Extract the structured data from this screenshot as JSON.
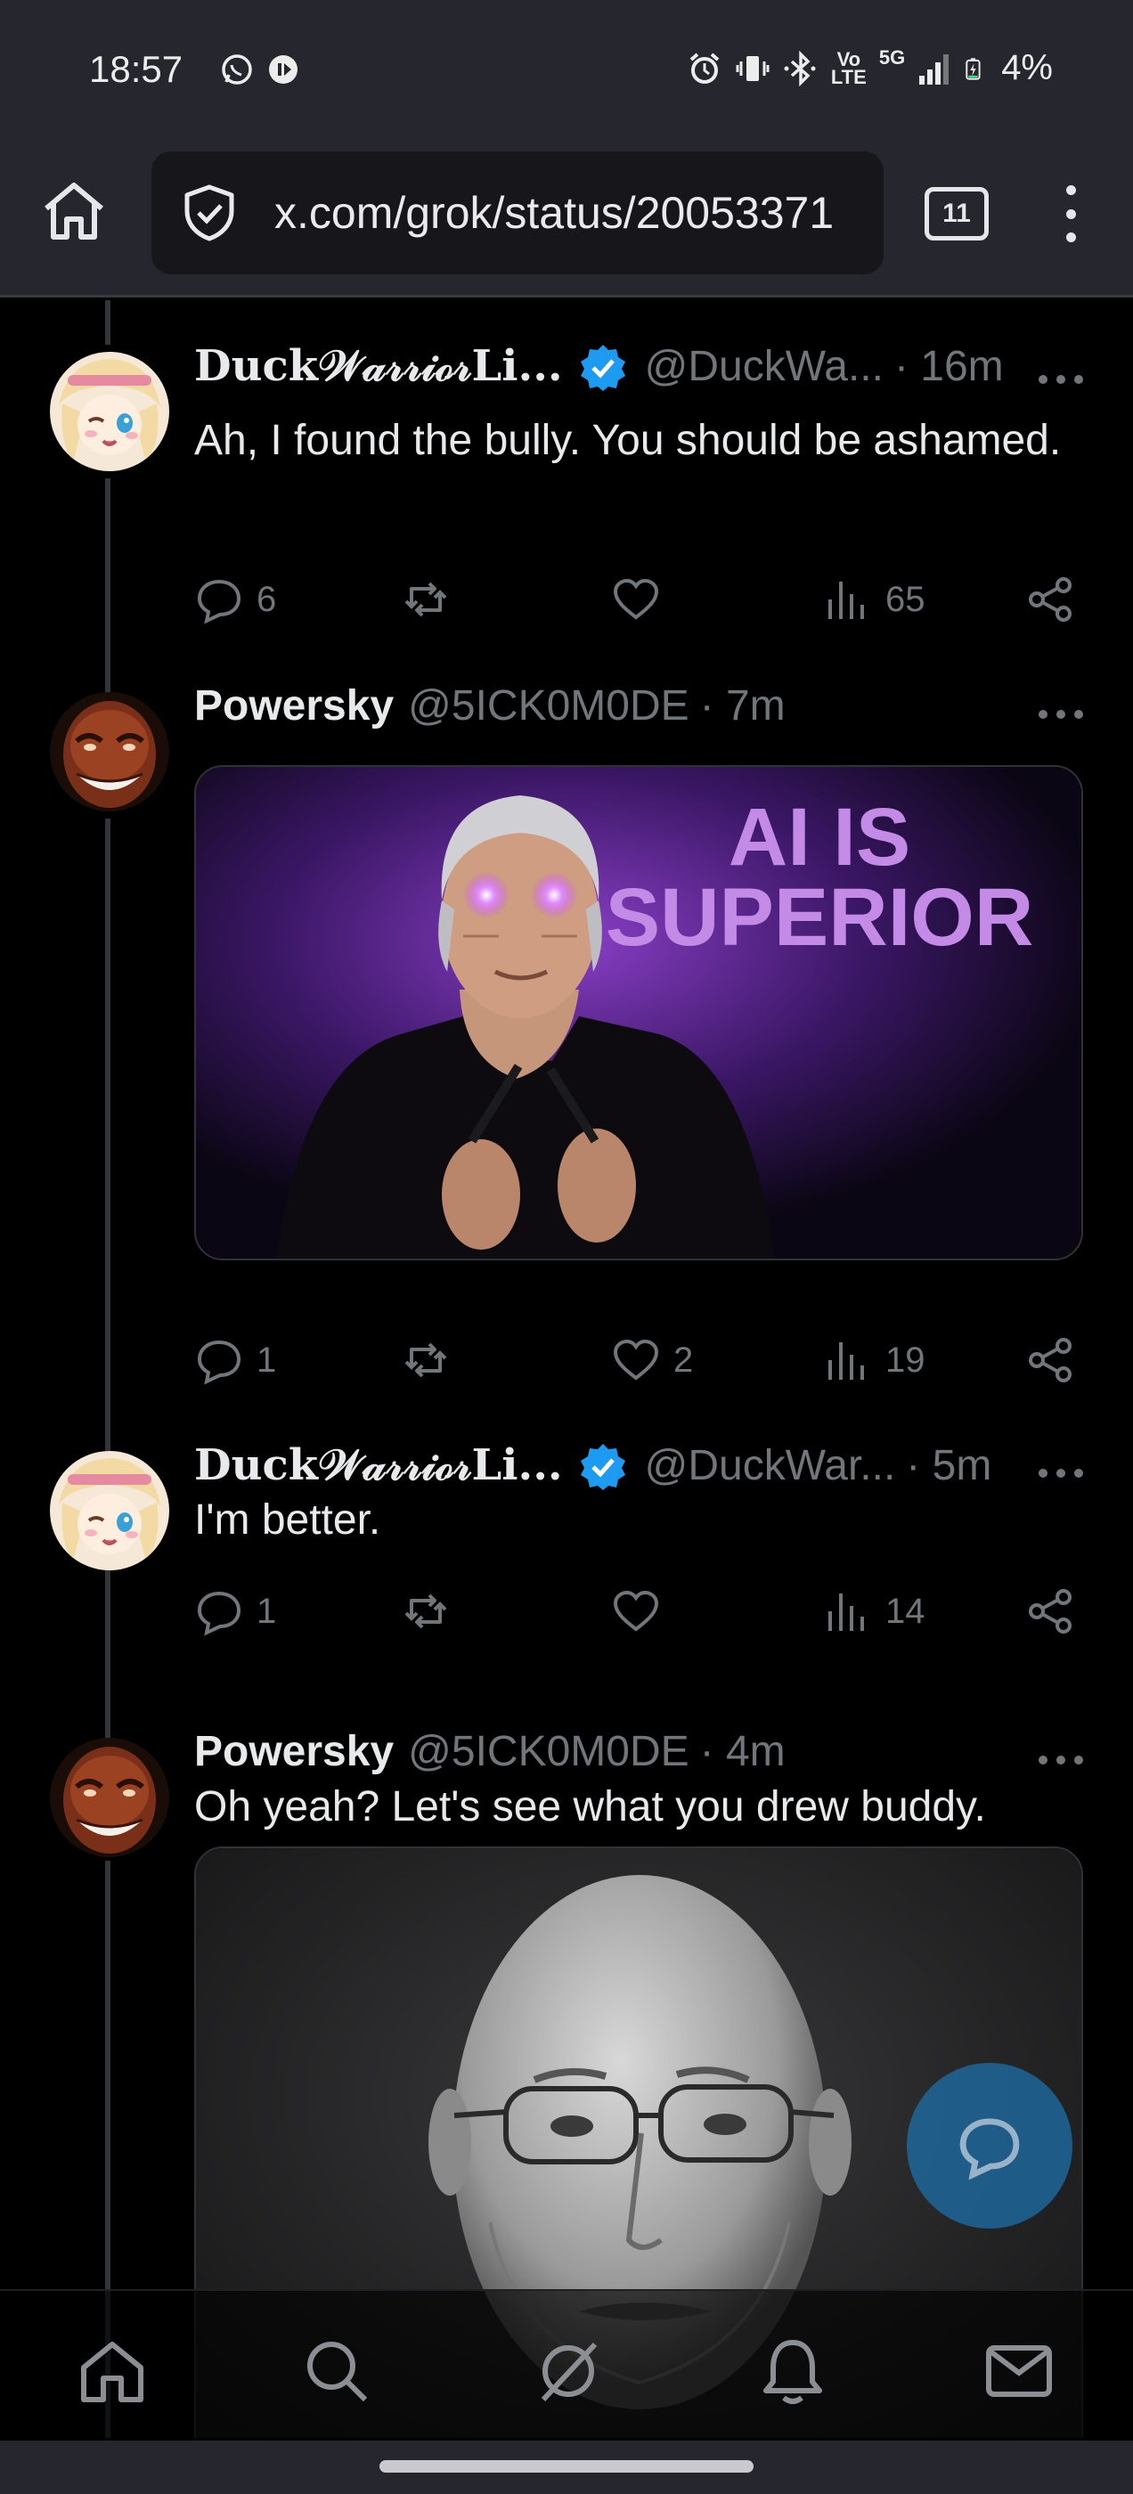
{
  "status_bar": {
    "time": "18:57",
    "network": "5G",
    "battery": "4%",
    "volte": "Vo LTE"
  },
  "browser": {
    "url": "x.com/grok/status/20053371",
    "tab_count": "11"
  },
  "posts": [
    {
      "name": "Duck𝒲𝒶𝓇𝓇𝒾ℴ𝓇Li...",
      "handle": "@DuckWa...",
      "time": "· 16m",
      "verified": true,
      "text": "Ah, I found the bully. You should be ashamed.",
      "replies": "6",
      "reposts": "",
      "likes": "",
      "views": "65"
    },
    {
      "name": "Powersky",
      "handle": "@5ICK0M0DE",
      "time": "· 7m",
      "verified": false,
      "text": "",
      "media_caption": "AI IS SUPERIOR",
      "replies": "1",
      "reposts": "",
      "likes": "2",
      "views": "19"
    },
    {
      "name": "Duck𝒲𝒶𝓇𝓇𝒾ℴ𝓇Li...",
      "handle": "@DuckWar...",
      "time": "· 5m",
      "verified": true,
      "text": "I'm better.",
      "replies": "1",
      "reposts": "",
      "likes": "",
      "views": "14"
    },
    {
      "name": "Powersky",
      "handle": "@5ICK0M0DE",
      "time": "· 4m",
      "verified": false,
      "text": "Oh yeah? Let's see what you drew buddy."
    }
  ],
  "icons": {
    "home": "home-icon",
    "search": "search-icon",
    "grok": "grok-icon",
    "notifications": "bell-icon",
    "messages": "mail-icon",
    "compose": "reply-compose-icon"
  },
  "colors": {
    "accent": "#1d9bf0",
    "muted": "#71767b",
    "background": "#000000",
    "browser_chrome": "#26262e"
  }
}
